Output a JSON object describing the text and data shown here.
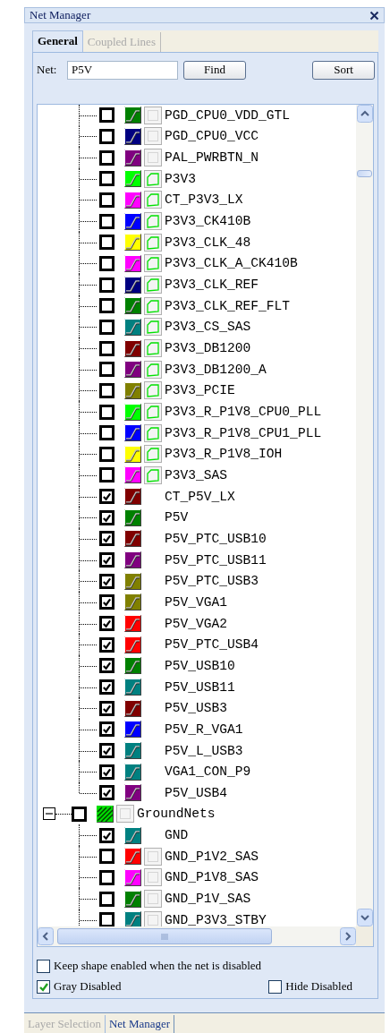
{
  "window": {
    "title": "Net Manager"
  },
  "tabs": [
    {
      "label": "General",
      "selected": true
    },
    {
      "label": "Coupled Lines",
      "selected": false
    }
  ],
  "net_field": {
    "label": "Net:",
    "value": "P5V"
  },
  "buttons": [
    "Find",
    "Sort"
  ],
  "tree": [
    {
      "kind": "continued",
      "children": [
        {
          "name": "PGD_CPU0_VDD_GTL",
          "checked": false,
          "color": "#008000",
          "kind": "dotted"
        },
        {
          "name": "PGD_CPU0_VCC",
          "checked": false,
          "color": "#000080",
          "kind": "dotted"
        },
        {
          "name": "PAL_PWRBTN_N",
          "checked": false,
          "color": "#800080",
          "kind": "dotted"
        },
        {
          "name": "P3V3",
          "checked": false,
          "color": "#00ff00",
          "kind": "outline"
        },
        {
          "name": "CT_P3V3_LX",
          "checked": false,
          "color": "#ff00ff",
          "kind": "outline"
        },
        {
          "name": "P3V3_CK410B",
          "checked": false,
          "color": "#0000ff",
          "kind": "outline"
        },
        {
          "name": "P3V3_CLK_48",
          "checked": false,
          "color": "#ffff00",
          "kind": "outline"
        },
        {
          "name": "P3V3_CLK_A_CK410B",
          "checked": false,
          "color": "#ff00ff",
          "kind": "outline"
        },
        {
          "name": "P3V3_CLK_REF",
          "checked": false,
          "color": "#000080",
          "kind": "outline"
        },
        {
          "name": "P3V3_CLK_REF_FLT",
          "checked": false,
          "color": "#008000",
          "kind": "outline"
        },
        {
          "name": "P3V3_CS_SAS",
          "checked": false,
          "color": "#008080",
          "kind": "outline"
        },
        {
          "name": "P3V3_DB1200",
          "checked": false,
          "color": "#800000",
          "kind": "outline"
        },
        {
          "name": "P3V3_DB1200_A",
          "checked": false,
          "color": "#800080",
          "kind": "outline"
        },
        {
          "name": "P3V3_PCIE",
          "checked": false,
          "color": "#808000",
          "kind": "outline"
        },
        {
          "name": "P3V3_R_P1V8_CPU0_PLL",
          "checked": false,
          "color": "#00ff00",
          "kind": "outline"
        },
        {
          "name": "P3V3_R_P1V8_CPU1_PLL",
          "checked": false,
          "color": "#0000ff",
          "kind": "outline"
        },
        {
          "name": "P3V3_R_P1V8_IOH",
          "checked": false,
          "color": "#ffff00",
          "kind": "outline"
        },
        {
          "name": "P3V3_SAS",
          "checked": false,
          "color": "#ff00ff",
          "kind": "outline"
        },
        {
          "name": "CT_P5V_LX",
          "checked": true,
          "color": "#800000",
          "kind": "plain"
        },
        {
          "name": "P5V",
          "checked": true,
          "color": "#008000",
          "kind": "plain"
        },
        {
          "name": "P5V_PTC_USB10",
          "checked": true,
          "color": "#800000",
          "kind": "plain"
        },
        {
          "name": "P5V_PTC_USB11",
          "checked": true,
          "color": "#800080",
          "kind": "plain"
        },
        {
          "name": "P5V_PTC_USB3",
          "checked": true,
          "color": "#808000",
          "kind": "plain"
        },
        {
          "name": "P5V_VGA1",
          "checked": true,
          "color": "#808000",
          "kind": "plain"
        },
        {
          "name": "P5V_VGA2",
          "checked": true,
          "color": "#ff0000",
          "kind": "plain"
        },
        {
          "name": "P5V_PTC_USB4",
          "checked": true,
          "color": "#ff0000",
          "kind": "plain"
        },
        {
          "name": "P5V_USB10",
          "checked": true,
          "color": "#008000",
          "kind": "plain"
        },
        {
          "name": "P5V_USB11",
          "checked": true,
          "color": "#008080",
          "kind": "plain"
        },
        {
          "name": "P5V_USB3",
          "checked": true,
          "color": "#800000",
          "kind": "plain"
        },
        {
          "name": "P5V_R_VGA1",
          "checked": true,
          "color": "#0000ff",
          "kind": "plain"
        },
        {
          "name": "P5V_L_USB3",
          "checked": true,
          "color": "#008080",
          "kind": "plain"
        },
        {
          "name": "VGA1_CON_P9",
          "checked": true,
          "color": "#008080",
          "kind": "plain"
        },
        {
          "name": "P5V_USB4",
          "checked": true,
          "color": "#800080",
          "kind": "plain"
        }
      ]
    },
    {
      "kind": "group",
      "name": "GroundNets",
      "expanded": true,
      "checked": false,
      "children": [
        {
          "name": "GND",
          "checked": true,
          "color": "#008080",
          "kind": "plain"
        },
        {
          "name": "GND_P1V2_SAS",
          "checked": false,
          "color": "#ff0000",
          "kind": "dotted"
        },
        {
          "name": "GND_P1V8_SAS",
          "checked": false,
          "color": "#ff00ff",
          "kind": "dotted"
        },
        {
          "name": "GND_P1V_SAS",
          "checked": false,
          "color": "#008000",
          "kind": "dotted"
        },
        {
          "name": "GND_P3V3_STBY",
          "checked": false,
          "color": "#008080",
          "kind": "dotted"
        }
      ]
    }
  ],
  "options": [
    {
      "label": "Keep shape enabled when the net is disabled",
      "checked": false
    },
    {
      "label": "Gray Disabled",
      "checked": true
    },
    {
      "label": "Hide Disabled",
      "checked": false
    }
  ],
  "bottom_tabs": [
    {
      "label": "Layer Selection",
      "selected": false
    },
    {
      "label": "Net Manager",
      "selected": true
    }
  ]
}
